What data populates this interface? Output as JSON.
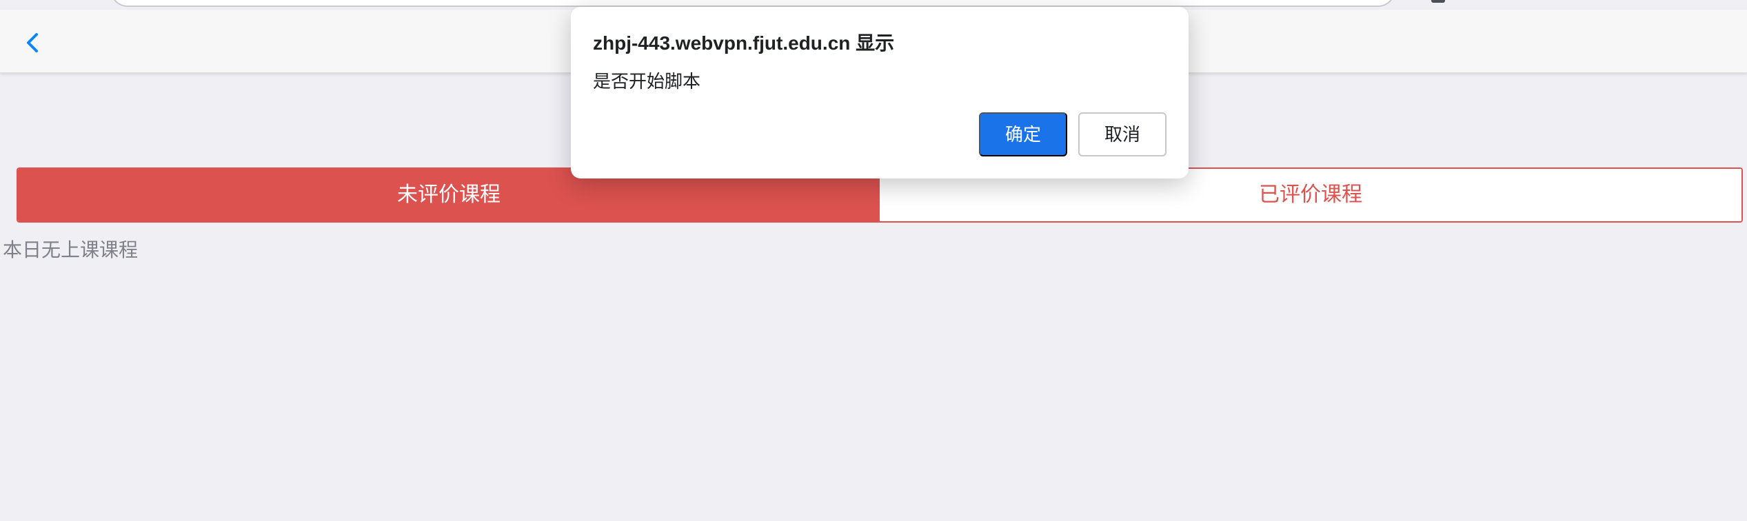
{
  "tabs": [
    {
      "label": "未评价课程",
      "active": true
    },
    {
      "label": "已评价课程",
      "active": false
    }
  ],
  "empty_text": "本日无上课课程",
  "dialog": {
    "title": "zhpj-443.webvpn.fjut.edu.cn 显示",
    "message": "是否开始脚本",
    "ok_label": "确定",
    "cancel_label": "取消"
  },
  "colors": {
    "page_background": "#efeff4",
    "navbar_background": "#f7f7f7",
    "accent_red": "#dc524f",
    "dialog_primary": "#1a73e8",
    "back_icon": "#0a84ff"
  },
  "icons": {
    "back": "chevron-left-icon"
  }
}
